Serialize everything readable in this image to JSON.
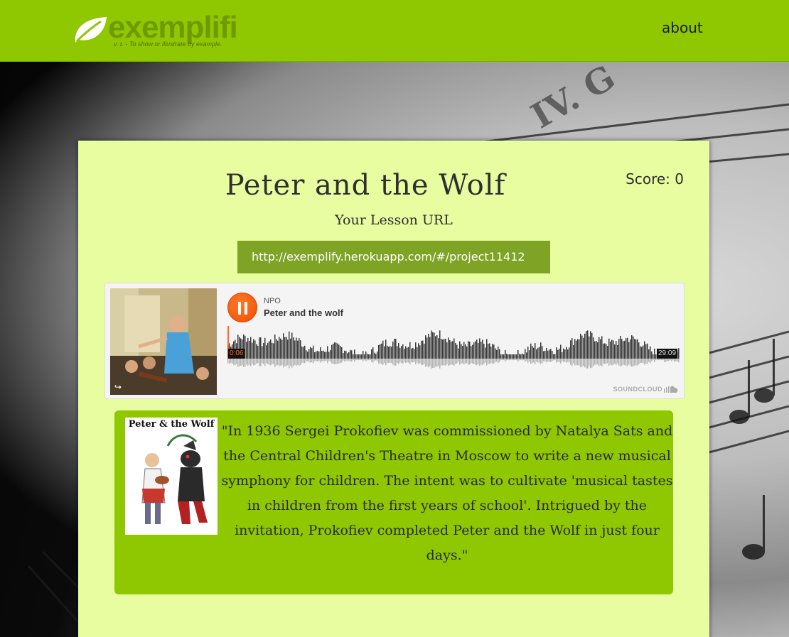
{
  "header": {
    "logo_text": "exemplifi",
    "tagline": "v. t. - To show or illustrate by example.",
    "nav_about": "about"
  },
  "lesson": {
    "title": "Peter and the Wolf",
    "score": "Score: 0",
    "url_label": "Your Lesson URL",
    "url": "http://exemplify.herokuapp.com/#/project11412"
  },
  "player": {
    "uploader": "NPO",
    "track_title": "Peter and the wolf",
    "current_time": "0:06",
    "total_time": "29:09",
    "progress": 0.0034,
    "brand": "SOUNDCLOUD",
    "accent_color": "#ff5500"
  },
  "description": {
    "book_title": "Peter & the Wolf",
    "quote": "\"In 1936 Sergei Prokofiev was commissioned by Natalya Sats and the Central Children's Theatre in Moscow to write a new musical symphony for children. The intent was to cultivate 'musical tastes in children from the first years of school'. Intrigued by the invitation, Prokofiev completed Peter and the Wolf in just four days.\""
  },
  "colors": {
    "header_green": "#8fc800",
    "panel": "#e8fca0",
    "url_box": "#7ea325"
  }
}
